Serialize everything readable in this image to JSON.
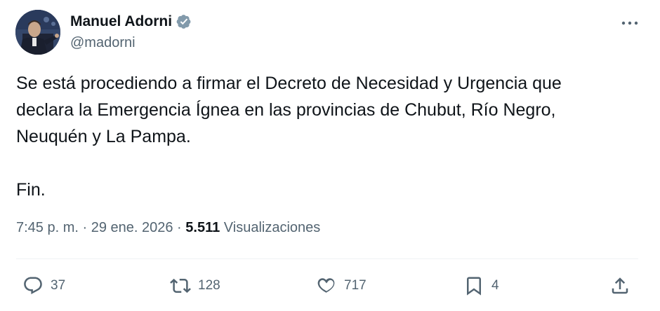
{
  "author": {
    "display_name": "Manuel Adorni",
    "handle": "@madorni",
    "verified_icon": "verified-badge-icon",
    "verified_color": "#829aab"
  },
  "tweet": {
    "text": "Se está procediendo a firmar el Decreto de Necesidad y Urgencia que\ndeclara la Emergencia Ígnea en las provincias de Chubut, Río Negro,\nNeuquén y La Pampa.\n\nFin.",
    "time": "7:45 p. m.",
    "separator": " · ",
    "date": "29 ene. 2026",
    "views_count": "5.511",
    "views_label": " Visualizaciones"
  },
  "actions": {
    "replies": "37",
    "reposts": "128",
    "likes": "717",
    "bookmarks": "4"
  },
  "icons": {
    "more": "more-options-icon",
    "reply": "reply-icon",
    "repost": "repost-icon",
    "like": "heart-icon",
    "bookmark": "bookmark-icon",
    "share": "share-icon"
  },
  "colors": {
    "text_primary": "#0f1419",
    "text_secondary": "#536471",
    "divider": "#eff3f4"
  }
}
